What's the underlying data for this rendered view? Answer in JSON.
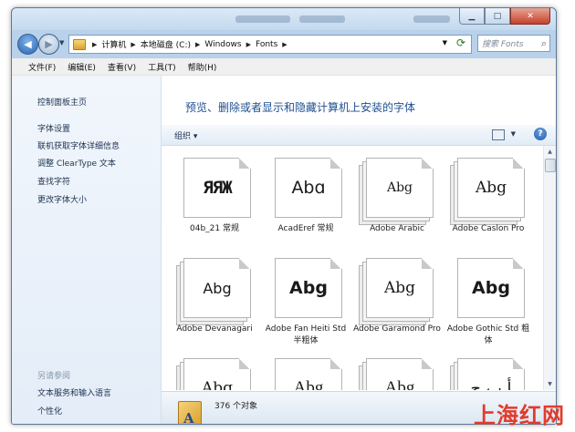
{
  "address": {
    "crumbs": [
      "计算机",
      "本地磁盘 (C:)",
      "Windows",
      "Fonts"
    ],
    "search_placeholder": "搜索 Fonts"
  },
  "menu": [
    "文件(F)",
    "编辑(E)",
    "查看(V)",
    "工具(T)",
    "帮助(H)"
  ],
  "left_pane": {
    "home": "控制面板主页",
    "links": [
      "字体设置",
      "联机获取字体详细信息",
      "调整 ClearType 文本",
      "查找字符",
      "更改字体大小"
    ],
    "see_also": "另请参阅",
    "see_also_links": [
      "文本服务和输入语言",
      "个性化"
    ]
  },
  "main": {
    "heading": "预览、删除或者显示和隐藏计算机上安装的字体",
    "organize": "组织 ▾",
    "fonts": [
      {
        "sample": "ЯЯЖ",
        "label": "04b_21 常规"
      },
      {
        "sample": "Abɑ",
        "label": "AcadEref 常规"
      },
      {
        "sample": "Abg",
        "label": "Adobe Arabic"
      },
      {
        "sample": "Abg",
        "label": "Adobe Caslon Pro"
      },
      {
        "sample": "Abg",
        "label": "Adobe Devanagari"
      },
      {
        "sample": "Abg",
        "label": "Adobe Fan Heiti Std 半粗体"
      },
      {
        "sample": "Abg",
        "label": "Adobe Garamond Pro"
      },
      {
        "sample": "Abg",
        "label": "Adobe Gothic Std 粗体"
      },
      {
        "sample": "Abg",
        "label": ""
      },
      {
        "sample": "Abg",
        "label": ""
      },
      {
        "sample": "Abg",
        "label": ""
      },
      {
        "sample": "أ ب ج",
        "label": ""
      }
    ],
    "status_count": "376 个对象"
  },
  "watermark": "上海红网"
}
